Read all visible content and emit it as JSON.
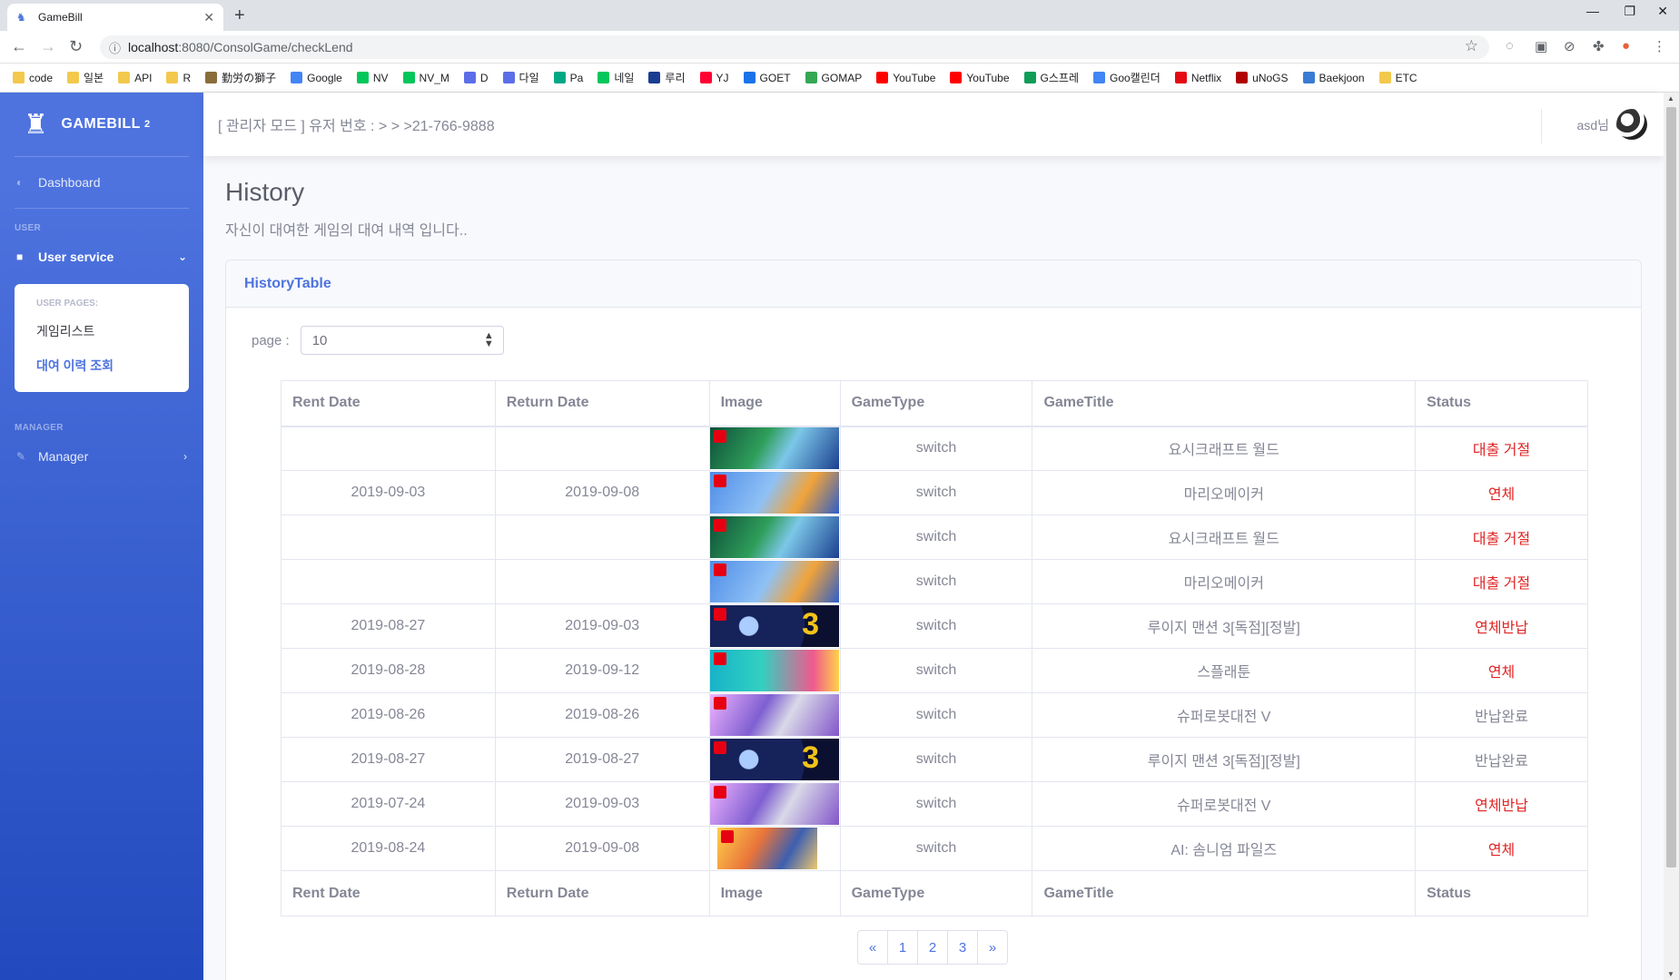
{
  "browser": {
    "tab_title": "GameBill",
    "url_host": "localhost",
    "url_path": ":8080/ConsolGame/checkLend",
    "bookmarks": [
      {
        "label": "code",
        "color": "#f2c94c"
      },
      {
        "label": "일본",
        "color": "#f2c94c"
      },
      {
        "label": "API",
        "color": "#f2c94c"
      },
      {
        "label": "R",
        "color": "#f2c94c"
      },
      {
        "label": "勤労の獅子",
        "color": "#8a6d3b"
      },
      {
        "label": "Google",
        "color": "#4285f4"
      },
      {
        "label": "NV",
        "color": "#03c75a"
      },
      {
        "label": "NV_M",
        "color": "#03c75a"
      },
      {
        "label": "D",
        "color": "#5b6ee8"
      },
      {
        "label": "다일",
        "color": "#5b6ee8"
      },
      {
        "label": "Pa",
        "color": "#00a884"
      },
      {
        "label": "네일",
        "color": "#03c75a"
      },
      {
        "label": "루리",
        "color": "#1a3d8f"
      },
      {
        "label": "YJ",
        "color": "#ff0033"
      },
      {
        "label": "GOET",
        "color": "#1a73e8"
      },
      {
        "label": "GOMAP",
        "color": "#34a853"
      },
      {
        "label": "YouTube",
        "color": "#ff0000"
      },
      {
        "label": "YouTube",
        "color": "#ff0000"
      },
      {
        "label": "G스프레",
        "color": "#0f9d58"
      },
      {
        "label": "Goo캘린더",
        "color": "#4285f4"
      },
      {
        "label": "Netflix",
        "color": "#e50914"
      },
      {
        "label": "uNoGS",
        "color": "#b00000"
      },
      {
        "label": "Baekjoon",
        "color": "#3a7bd5"
      },
      {
        "label": "ETC",
        "color": "#f2c94c"
      }
    ]
  },
  "sidebar": {
    "brand": "GAMEBILL",
    "brand_sup": "2",
    "dashboard": "Dashboard",
    "user_heading": "USER",
    "user_service": "User service",
    "user_pages_header": "USER PAGES:",
    "user_pages": [
      "게임리스트",
      "대여 이력 조회"
    ],
    "manager_heading": "MANAGER",
    "manager": "Manager"
  },
  "topbar": {
    "notice": "[ 관리자 모드 ] 유저 번호 : > > >21-766-9888",
    "username": "asd님"
  },
  "page": {
    "title": "History",
    "subtitle": "자신이 대여한 게임의 대여 내역 입니다.."
  },
  "card": {
    "title": "HistoryTable",
    "page_label": "page :",
    "page_size": "10"
  },
  "table": {
    "headers": [
      "Rent Date",
      "Return Date",
      "Image",
      "GameType",
      "GameTitle",
      "Status"
    ],
    "rows": [
      {
        "rent": "",
        "ret": "",
        "type": "switch",
        "title": "요시크래프트 월드",
        "status": "대출 거절",
        "red": true
      },
      {
        "rent": "2019-09-03",
        "ret": "2019-09-08",
        "type": "switch",
        "title": "마리오메이커",
        "status": "연체",
        "red": true
      },
      {
        "rent": "",
        "ret": "",
        "type": "switch",
        "title": "요시크래프트 월드",
        "status": "대출 거절",
        "red": true
      },
      {
        "rent": "",
        "ret": "",
        "type": "switch",
        "title": "마리오메이커",
        "status": "대출 거절",
        "red": true
      },
      {
        "rent": "2019-08-27",
        "ret": "2019-09-03",
        "type": "switch",
        "title": "루이지 맨션 3[독점][정발]",
        "status": "연체반납",
        "red": true
      },
      {
        "rent": "2019-08-28",
        "ret": "2019-09-12",
        "type": "switch",
        "title": "스플래툰",
        "status": "연체",
        "red": true
      },
      {
        "rent": "2019-08-26",
        "ret": "2019-08-26",
        "type": "switch",
        "title": "슈퍼로봇대전 V",
        "status": "반납완료",
        "red": false
      },
      {
        "rent": "2019-08-27",
        "ret": "2019-08-27",
        "type": "switch",
        "title": "루이지 맨션 3[독점][정발]",
        "status": "반납완료",
        "red": false
      },
      {
        "rent": "2019-07-24",
        "ret": "2019-09-03",
        "type": "switch",
        "title": "슈퍼로봇대전 V",
        "status": "연체반납",
        "red": true
      },
      {
        "rent": "2019-08-24",
        "ret": "2019-09-08",
        "type": "switch",
        "title": "AI: 솜니엄 파일즈",
        "status": "연체",
        "red": true
      }
    ]
  },
  "pagination": [
    "«",
    "1",
    "2",
    "3",
    "»"
  ],
  "icons": {
    "dashboard": "tachometer-icon",
    "user_service": "folder-icon",
    "manager": "wrench-icon"
  }
}
